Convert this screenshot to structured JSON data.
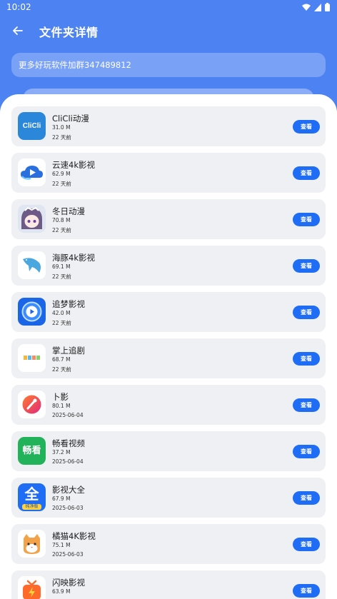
{
  "status_bar": {
    "time": "10:02"
  },
  "appbar": {
    "title": "文件夹详情"
  },
  "banner": {
    "text": "更多好玩软件加群347489812"
  },
  "items": [
    {
      "name": "CliCli动漫",
      "size": "31.0 M",
      "date": "22 天前",
      "button": "查看",
      "icon": "clicli-icon",
      "icon_text": "CliCli"
    },
    {
      "name": "云速4k影视",
      "size": "62.9 M",
      "date": "22 天前",
      "button": "查看",
      "icon": "cloud-play-icon"
    },
    {
      "name": "冬日动漫",
      "size": "70.8 M",
      "date": "22 天前",
      "button": "查看",
      "icon": "anime-girl-icon"
    },
    {
      "name": "海豚4k影视",
      "size": "69.1 M",
      "date": "22 天前",
      "button": "查看",
      "icon": "dolphin-icon"
    },
    {
      "name": "追梦影视",
      "size": "42.0 M",
      "date": "22 天前",
      "button": "查看",
      "icon": "play-circle-icon"
    },
    {
      "name": "掌上追剧",
      "size": "68.7 M",
      "date": "22 天前",
      "button": "查看",
      "icon": "drama-blocks-icon"
    },
    {
      "name": "卜影",
      "size": "80.1 M",
      "date": "2025-06-04",
      "button": "查看",
      "icon": "gradient-circle-icon"
    },
    {
      "name": "畅看视频",
      "size": "37.2 M",
      "date": "2025-06-04",
      "button": "查看",
      "icon": "changkan-icon",
      "icon_text": "畅看"
    },
    {
      "name": "影视大全",
      "size": "67.9 M",
      "date": "2025-06-03",
      "button": "查看",
      "icon": "quan-icon",
      "icon_text": "全",
      "icon_subtext": "纯净版"
    },
    {
      "name": "橘猫4K影视",
      "size": "75.1 M",
      "date": "2025-06-03",
      "button": "查看",
      "icon": "cat-icon"
    },
    {
      "name": "闪映影视",
      "size": "63.9 M",
      "date": "",
      "button": "查看",
      "icon": "tv-bolt-icon"
    }
  ]
}
